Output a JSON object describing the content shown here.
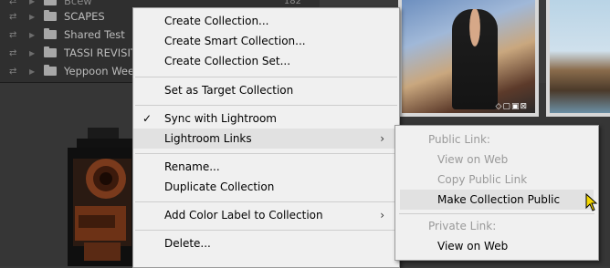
{
  "collections_panel": {
    "rows": [
      {
        "name": "Bcew",
        "count": "182"
      },
      {
        "name": "SCAPES",
        "count": ""
      },
      {
        "name": "Shared Test",
        "count": ""
      },
      {
        "name": "TASSI REVISIT",
        "count": ""
      },
      {
        "name": "Yeppoon Wee",
        "count": ""
      }
    ]
  },
  "context_menu": {
    "items": [
      {
        "label": "Create Collection..."
      },
      {
        "label": "Create Smart Collection..."
      },
      {
        "label": "Create Collection Set..."
      },
      {
        "label": "Set as Target Collection"
      },
      {
        "label": "Sync with Lightroom",
        "check": "✓"
      },
      {
        "label": "Lightroom Links",
        "arrow": "›"
      },
      {
        "label": "Rename..."
      },
      {
        "label": "Duplicate Collection"
      },
      {
        "label": "Add Color Label to Collection",
        "arrow": "›"
      },
      {
        "label": "Delete..."
      }
    ]
  },
  "submenu": {
    "public_header": "Public Link:",
    "view_on_web_disabled": "View on Web",
    "copy_public_link": "Copy Public Link",
    "make_public": "Make Collection Public",
    "private_header": "Private Link:",
    "view_on_web": "View on Web"
  },
  "accent_colors": {
    "menu_bg": "#f0f0f0",
    "highlight": "#e1e1e1",
    "disabled_text": "#9a9a9a",
    "cursor": "#f5d800"
  }
}
